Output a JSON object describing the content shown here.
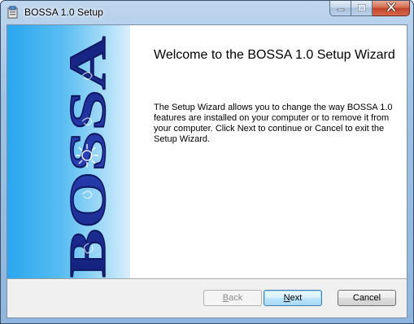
{
  "window": {
    "title": "BOSSA 1.0 Setup"
  },
  "banner": {
    "logo_text": "BOSSA",
    "colors": {
      "gradient_start": "#2aa6ee",
      "gradient_end": "#d8eefb",
      "letters": "#1f2f9a"
    }
  },
  "content": {
    "heading": "Welcome to the BOSSA 1.0 Setup Wizard",
    "description": "The Setup Wizard allows you to change the way BOSSA 1.0 features are installed on your computer or to remove it from your computer. Click Next to continue or Cancel to exit the Setup Wizard."
  },
  "buttons": {
    "back": {
      "label_mnemonic": "B",
      "label_rest": "ack",
      "enabled": false
    },
    "next": {
      "label_mnemonic": "N",
      "label_rest": "ext",
      "enabled": true
    },
    "cancel": {
      "label": "Cancel",
      "enabled": true
    }
  },
  "icons": {
    "app": "installer-icon",
    "minimize": "minimize-icon",
    "maximize": "maximize-icon",
    "close": "close-icon"
  }
}
